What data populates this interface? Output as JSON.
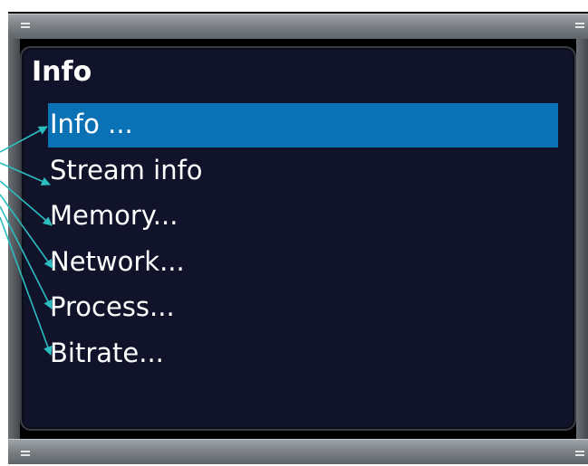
{
  "dialog": {
    "title": "Info",
    "selected_index": 0,
    "menu_items": [
      "Info ...",
      "Stream info",
      "Memory...",
      "Network...",
      "Process...",
      "Bitrate..."
    ]
  },
  "colors": {
    "panel_background": "#10132a",
    "selection_highlight": "#0a72b4",
    "annotation_arrow": "#2bbdc0",
    "text": "#ffffff",
    "frame_bar": "#7d8287"
  }
}
